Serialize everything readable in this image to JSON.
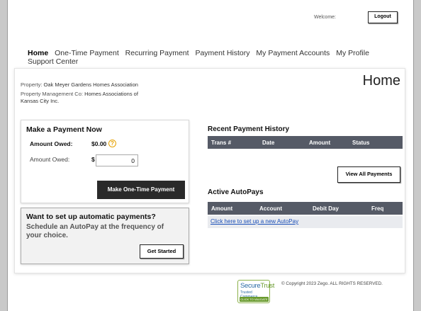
{
  "header": {
    "welcome_label": "Welcome:",
    "logout_label": "Logout"
  },
  "nav": {
    "items": [
      "Home",
      "One-Time Payment",
      "Recurring Payment",
      "Payment History",
      "My Payment Accounts",
      "My Profile",
      "Support Center"
    ]
  },
  "property": {
    "property_label": "Property:",
    "property_value": "Oak Meyer Gardens Homes Association",
    "mgmt_label": "Property Management Co:",
    "mgmt_value_line1": "Homes Associations of",
    "mgmt_value_line2": "Kansas City Inc."
  },
  "page_title": "Home",
  "make_payment": {
    "title": "Make a Payment Now",
    "owed_label": "Amount Owed:",
    "owed_value": "$0.00",
    "help_icon": "?",
    "amount_label": "Amount Owed:",
    "currency": "$",
    "amount_value": "0",
    "button_label": "Make One-Time Payment"
  },
  "autopay_promo": {
    "title": "Want to set up automatic payments?",
    "description": "Schedule an AutoPay at the frequency of your choice.",
    "button_label": "Get Started"
  },
  "recent_history": {
    "title": "Recent Payment History",
    "columns": [
      "Trans #",
      "Date",
      "Amount",
      "Status"
    ],
    "view_all_label": "View All Payments"
  },
  "active_autopays": {
    "title": "Active AutoPays",
    "columns": [
      "Amount",
      "Account",
      "Debit Day",
      "Freq"
    ],
    "setup_link": "Click here to set up a new AutoPay"
  },
  "footer": {
    "seal_line1a": "Secure",
    "seal_line1b": "Trust",
    "seal_line2": "Trusted Commerce",
    "seal_line3": "CLICK TO VALIDATE",
    "copyright": "© Copyright 2023 Zego. ALL RIGHTS RESERVED."
  },
  "colors": {
    "table_header": "#555a66",
    "button_dark": "#2a2a2a",
    "link": "#1a4fb8",
    "help_icon": "#e6a100"
  }
}
